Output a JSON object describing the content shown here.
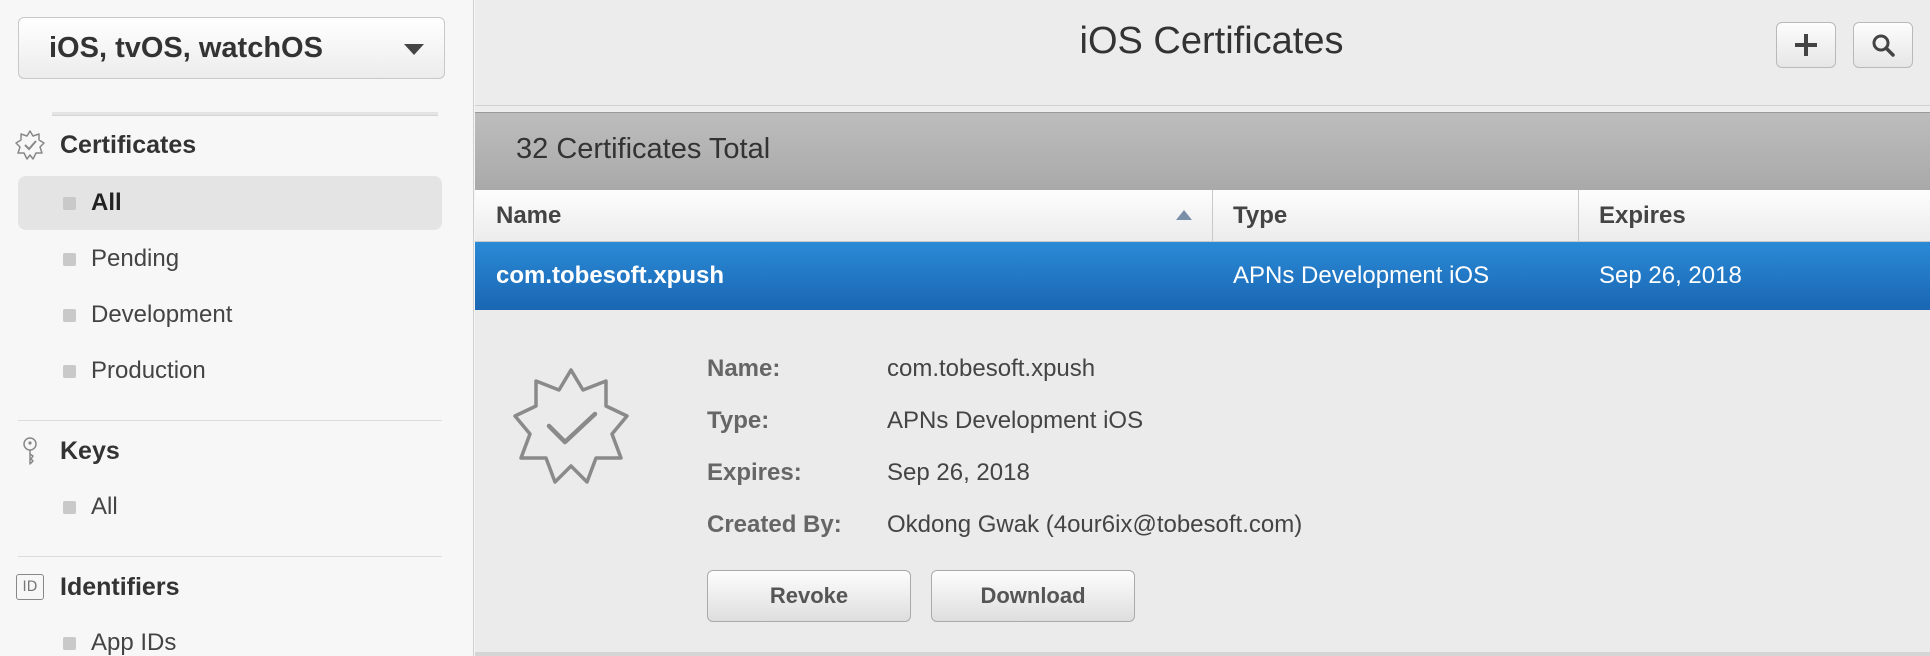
{
  "sidebar": {
    "platform": "iOS, tvOS, watchOS",
    "sections": {
      "certificates": {
        "title": "Certificates",
        "icon": "certificate-badge-icon",
        "items": [
          "All",
          "Pending",
          "Development",
          "Production"
        ]
      },
      "keys": {
        "title": "Keys",
        "icon": "key-icon",
        "items": [
          "All"
        ]
      },
      "identifiers": {
        "title": "Identifiers",
        "icon_text": "ID",
        "items": [
          "App IDs"
        ]
      }
    }
  },
  "header": {
    "title": "iOS Certificates",
    "add_icon": "plus-icon",
    "search_icon": "search-icon"
  },
  "summary": "32 Certificates Total",
  "table": {
    "columns": [
      "Name",
      "Type",
      "Expires"
    ],
    "rows": [
      {
        "name": "com.tobesoft.xpush",
        "type": "APNs Development iOS",
        "expires": "Sep 26, 2018"
      }
    ]
  },
  "detail": {
    "labels": {
      "name": "Name:",
      "type": "Type:",
      "expires": "Expires:",
      "created_by": "Created By:"
    },
    "values": {
      "name": "com.tobesoft.xpush",
      "type": "APNs Development iOS",
      "expires": "Sep 26, 2018",
      "created_by": "Okdong Gwak (4our6ix@tobesoft.com)"
    },
    "buttons": {
      "revoke": "Revoke",
      "download": "Download"
    }
  },
  "colors": {
    "selection": "#1f74c3",
    "sidebar_bg": "#f7f7f7",
    "main_bg": "#ededed"
  }
}
